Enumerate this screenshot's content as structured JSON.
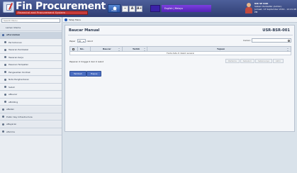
{
  "header": {
    "app_title": "Fin Procurement",
    "app_subtitle": "Financial and Procurement System",
    "toolbar": {
      "home_label": "Home",
      "btn_minus": "−",
      "btn_font": "A",
      "btn_font_plus": "A+"
    },
    "language": "English | Melayu",
    "user": {
      "name": "NIK SE KOK",
      "role": "Sistem Pentadbir (Admin)",
      "datetime": "Jumaat, 13 September 2019 - 12:21:48",
      "extra": "PM"
    }
  },
  "sidebar": {
    "search_placeholder": "Search Menu",
    "items": [
      {
        "label": "Laman Utama",
        "type": "top"
      },
      {
        "label": "ePerolehan",
        "type": "section"
      },
      {
        "label": "Permohonan",
        "type": "sub"
      },
      {
        "label": "Tawaran Pembekal",
        "type": "sub"
      },
      {
        "label": "Tawaran Kerja",
        "type": "sub"
      },
      {
        "label": "Pesanan Tempatan",
        "type": "sub"
      },
      {
        "label": "Pengesahan Kontrak",
        "type": "sub"
      },
      {
        "label": "Nota Penghantaran",
        "type": "sub"
      },
      {
        "label": "Sebut",
        "type": "sub"
      },
      {
        "label": "eBaucar",
        "type": "sub"
      },
      {
        "label": "eBidding",
        "type": "sub"
      },
      {
        "label": "eBelian",
        "type": "root"
      },
      {
        "label": "Public Key Infrastructure",
        "type": "root"
      },
      {
        "label": "eBayaran",
        "type": "root"
      },
      {
        "label": "eTerima",
        "type": "root"
      }
    ]
  },
  "breadcrumb": "Tetap Menu",
  "panel": {
    "title": "Baucar Manual",
    "code": "USR-BSR-001",
    "show_prefix": "Papar",
    "show_value": "10",
    "show_suffix": "rekod",
    "find_label": "Carian:",
    "find_value": "",
    "table": {
      "headers": [
        "No.",
        "Baucar",
        "Tarikh",
        "Tujuan"
      ],
      "empty_text": "Tiada data di dalam senarai"
    },
    "info": "Paparan 0 hingga 0 dari 0 rekod",
    "pager": [
      "Pertama",
      "Sebelum",
      "Seterusnya",
      "Akhir"
    ],
    "buttons": {
      "add": "Tambah",
      "delete": "Hapus"
    }
  }
}
